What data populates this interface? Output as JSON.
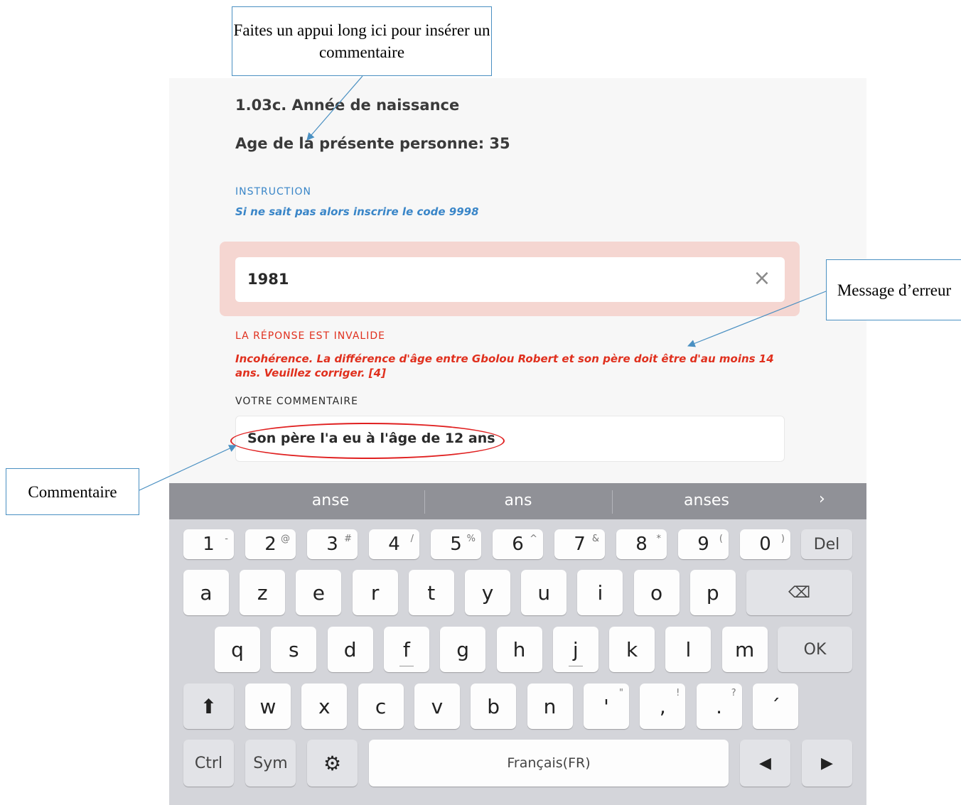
{
  "callouts": {
    "top": "Faites un appui long ici pour insérer un commentaire",
    "error": "Message d’erreur",
    "comment": "Commentaire"
  },
  "question": {
    "title": "1.03c. Année de naissance",
    "subtitle": "Age de la présente personne: 35",
    "instruction_label": "INSTRUCTION",
    "instruction_text": "Si ne sait pas alors inscrire le code 9998",
    "answer_value": "1981",
    "error_label": "LA RÉPONSE EST INVALIDE",
    "error_text": "Incohérence. La différence d'âge entre Gbolou Robert et son père doit être d'au moins 14 ans. Veuillez corriger. [4]",
    "comment_label": "VOTRE COMMENTAIRE",
    "comment_value": "Son père l'a eu à l'âge de 12 ans"
  },
  "keyboard": {
    "suggestions": [
      "anse",
      "ans",
      "anses"
    ],
    "more": "›",
    "row1": [
      {
        "k": "1",
        "s": "-"
      },
      {
        "k": "2",
        "s": "@"
      },
      {
        "k": "3",
        "s": "#"
      },
      {
        "k": "4",
        "s": "/"
      },
      {
        "k": "5",
        "s": "%"
      },
      {
        "k": "6",
        "s": "^"
      },
      {
        "k": "7",
        "s": "&"
      },
      {
        "k": "8",
        "s": "*"
      },
      {
        "k": "9",
        "s": "("
      },
      {
        "k": "0",
        "s": ")"
      }
    ],
    "del": "Del",
    "row2": [
      "a",
      "z",
      "e",
      "r",
      "t",
      "y",
      "u",
      "i",
      "o",
      "p"
    ],
    "backspace": "⌫",
    "row3": [
      "q",
      "s",
      "d",
      "f",
      "g",
      "h",
      "j",
      "k",
      "l",
      "m"
    ],
    "ok": "OK",
    "shift": "⬆",
    "row4": [
      "w",
      "x",
      "c",
      "v",
      "b",
      "n"
    ],
    "punct": [
      {
        "k": "'",
        "s": "\""
      },
      {
        "k": ",",
        "s": "!"
      },
      {
        "k": ".",
        "s": "?"
      },
      {
        "k": "´",
        "s": ""
      }
    ],
    "ctrl": "Ctrl",
    "sym": "Sym",
    "settings": "⚙",
    "space": "Français(FR)",
    "left": "◀",
    "right": "▶"
  }
}
